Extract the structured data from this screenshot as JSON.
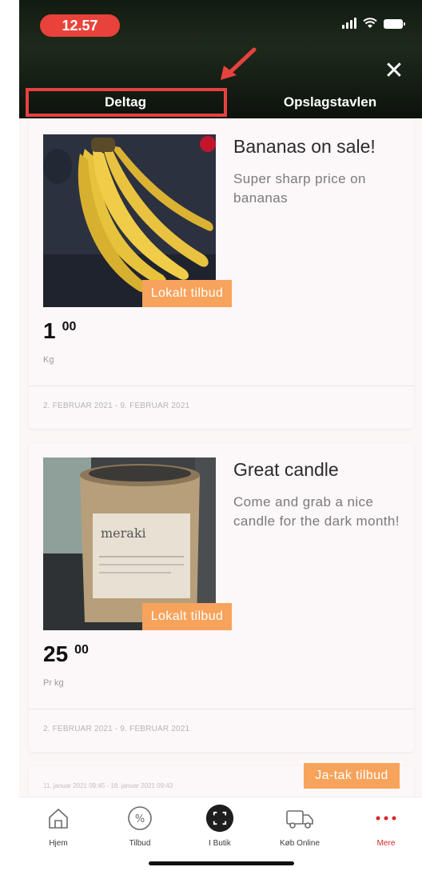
{
  "status_bar": {
    "time": "12.57"
  },
  "tabs": [
    {
      "label": "Deltag"
    },
    {
      "label": "Opslagstavlen"
    }
  ],
  "offers": [
    {
      "title": "Bananas on sale!",
      "description": "Super sharp price on bananas",
      "badge": "Lokalt tilbud",
      "price_main": "1",
      "price_cents": "00",
      "unit": "Kg",
      "date_range": "2. FEBRUAR 2021 - 9. FEBRUAR 2021"
    },
    {
      "title": "Great candle",
      "description": "Come and grab a nice candle for the dark month!",
      "badge": "Lokalt tilbud",
      "price_main": "25",
      "price_cents": "00",
      "unit": "Pr kg",
      "date_range": "2. FEBRUAR 2021 - 9. FEBRUAR 2021",
      "image_label": "meraki"
    }
  ],
  "partial_offer": {
    "date_range": "11. januar 2021 09:45 - 18. januar 2021 09:43",
    "badge": "Ja-tak tilbud"
  },
  "bottom_nav": [
    {
      "label": "Hjem",
      "icon": "home-icon"
    },
    {
      "label": "Tilbud",
      "icon": "percent-icon"
    },
    {
      "label": "I Butik",
      "icon": "scan-icon"
    },
    {
      "label": "Køb Online",
      "icon": "delivery-truck-icon"
    },
    {
      "label": "Mere",
      "icon": "more-dots-icon"
    }
  ],
  "colors": {
    "accent_orange": "#f7a35b",
    "highlight_red": "#e74240",
    "nav_active_red": "#d9262c"
  }
}
